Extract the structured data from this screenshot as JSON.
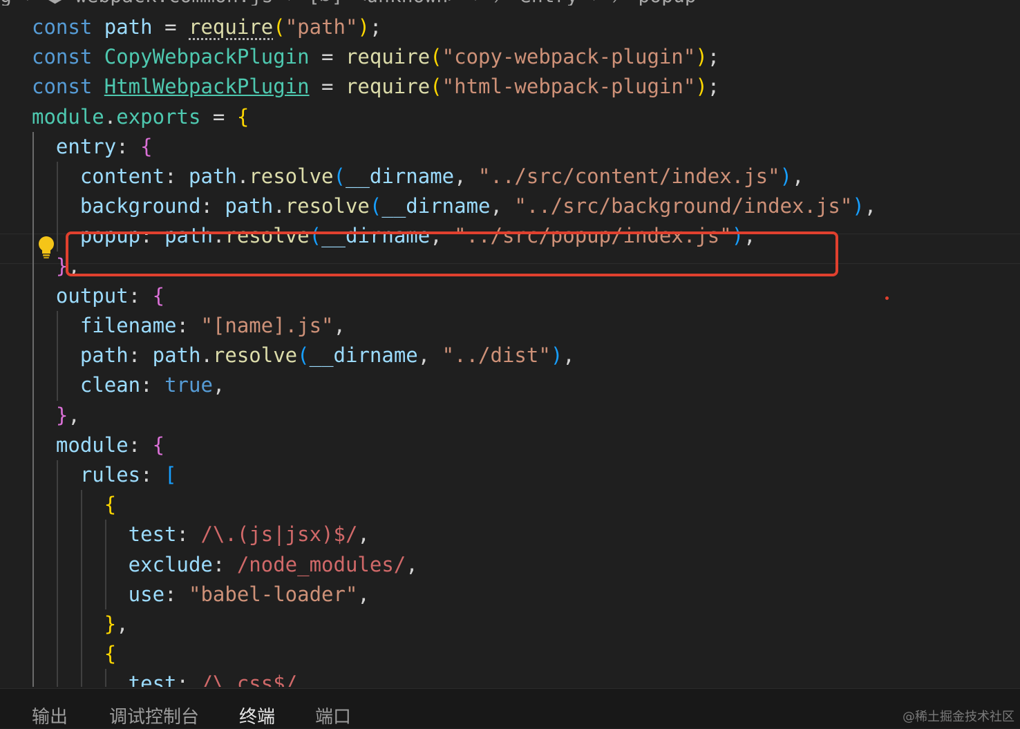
{
  "breadcrumb": {
    "text": "g › ⬢ webpack.common.js › [∅] <unknown> › ⟋ entry › ⟋ popup"
  },
  "editor": {
    "language": "javascript",
    "lines": [
      [
        [
          "t-kw",
          "const "
        ],
        [
          "t-var",
          "path"
        ],
        [
          "t-p",
          " = "
        ],
        [
          "t-fn t-dot",
          "require"
        ],
        [
          "t-b1",
          "("
        ],
        [
          "t-str",
          "\"path\""
        ],
        [
          "t-b1",
          ")"
        ],
        [
          "t-p",
          ";"
        ]
      ],
      [
        [
          "t-kw",
          "const "
        ],
        [
          "t-cls",
          "CopyWebpackPlugin"
        ],
        [
          "t-p",
          " = "
        ],
        [
          "t-fn",
          "require"
        ],
        [
          "t-b1",
          "("
        ],
        [
          "t-str",
          "\"copy-webpack-plugin\""
        ],
        [
          "t-b1",
          ")"
        ],
        [
          "t-p",
          ";"
        ]
      ],
      [
        [
          "t-kw",
          "const "
        ],
        [
          "t-cls t-und",
          "HtmlWebpackPlugin"
        ],
        [
          "t-p",
          " = "
        ],
        [
          "t-fn",
          "require"
        ],
        [
          "t-b1",
          "("
        ],
        [
          "t-str",
          "\"html-webpack-plugin\""
        ],
        [
          "t-b1",
          ")"
        ],
        [
          "t-p",
          ";"
        ]
      ],
      [
        [
          "t-cls",
          "module"
        ],
        [
          "t-p",
          "."
        ],
        [
          "t-cls",
          "exports"
        ],
        [
          "t-p",
          " = "
        ],
        [
          "t-b1",
          "{"
        ]
      ],
      [
        [
          "t-prop",
          "  entry"
        ],
        [
          "t-p",
          ": "
        ],
        [
          "t-b2",
          "{"
        ]
      ],
      [
        [
          "t-prop",
          "    content"
        ],
        [
          "t-p",
          ": "
        ],
        [
          "t-var",
          "path"
        ],
        [
          "t-p",
          "."
        ],
        [
          "t-fn",
          "resolve"
        ],
        [
          "t-b3",
          "("
        ],
        [
          "t-var",
          "__dirname"
        ],
        [
          "t-p",
          ", "
        ],
        [
          "t-str",
          "\"../src/content/index.js\""
        ],
        [
          "t-b3",
          ")"
        ],
        [
          "t-p",
          ","
        ]
      ],
      [
        [
          "t-prop",
          "    background"
        ],
        [
          "t-p",
          ": "
        ],
        [
          "t-var",
          "path"
        ],
        [
          "t-p",
          "."
        ],
        [
          "t-fn",
          "resolve"
        ],
        [
          "t-b3",
          "("
        ],
        [
          "t-var",
          "__dirname"
        ],
        [
          "t-p",
          ", "
        ],
        [
          "t-str",
          "\"../src/background/index.js\""
        ],
        [
          "t-b3",
          ")"
        ],
        [
          "t-p",
          ","
        ]
      ],
      [
        [
          "t-prop",
          "    popup"
        ],
        [
          "t-p",
          ": "
        ],
        [
          "t-var",
          "path"
        ],
        [
          "t-p",
          "."
        ],
        [
          "t-fn",
          "resolve"
        ],
        [
          "t-b3",
          "("
        ],
        [
          "t-var",
          "__dirname"
        ],
        [
          "t-p",
          ", "
        ],
        [
          "t-str",
          "\"../src/popup/index.js\""
        ],
        [
          "t-b3",
          ")"
        ],
        [
          "t-p",
          ","
        ]
      ],
      [
        [
          "t-b2",
          "  }"
        ],
        [
          "t-p",
          ","
        ]
      ],
      [
        [
          "t-prop",
          "  output"
        ],
        [
          "t-p",
          ": "
        ],
        [
          "t-b2",
          "{"
        ]
      ],
      [
        [
          "t-prop",
          "    filename"
        ],
        [
          "t-p",
          ": "
        ],
        [
          "t-str",
          "\"[name].js\""
        ],
        [
          "t-p",
          ","
        ]
      ],
      [
        [
          "t-prop",
          "    path"
        ],
        [
          "t-p",
          ": "
        ],
        [
          "t-var",
          "path"
        ],
        [
          "t-p",
          "."
        ],
        [
          "t-fn",
          "resolve"
        ],
        [
          "t-b3",
          "("
        ],
        [
          "t-var",
          "__dirname"
        ],
        [
          "t-p",
          ", "
        ],
        [
          "t-str",
          "\"../dist\""
        ],
        [
          "t-b3",
          ")"
        ],
        [
          "t-p",
          ","
        ]
      ],
      [
        [
          "t-prop",
          "    clean"
        ],
        [
          "t-p",
          ": "
        ],
        [
          "t-bool",
          "true"
        ],
        [
          "t-p",
          ","
        ]
      ],
      [
        [
          "t-b2",
          "  }"
        ],
        [
          "t-p",
          ","
        ]
      ],
      [
        [
          "t-prop",
          "  module"
        ],
        [
          "t-p",
          ": "
        ],
        [
          "t-b2",
          "{"
        ]
      ],
      [
        [
          "t-prop",
          "    rules"
        ],
        [
          "t-p",
          ": "
        ],
        [
          "t-b3",
          "["
        ]
      ],
      [
        [
          "t-b1",
          "      {"
        ]
      ],
      [
        [
          "t-prop",
          "        test"
        ],
        [
          "t-p",
          ": "
        ],
        [
          "t-re",
          "/\\.(js|jsx)$/"
        ],
        [
          "t-p",
          ","
        ]
      ],
      [
        [
          "t-prop",
          "        exclude"
        ],
        [
          "t-p",
          ": "
        ],
        [
          "t-re",
          "/node_modules/"
        ],
        [
          "t-p",
          ","
        ]
      ],
      [
        [
          "t-prop",
          "        use"
        ],
        [
          "t-p",
          ": "
        ],
        [
          "t-str",
          "\"babel-loader\""
        ],
        [
          "t-p",
          ","
        ]
      ],
      [
        [
          "t-b1",
          "      }"
        ],
        [
          "t-p",
          ","
        ]
      ],
      [
        [
          "t-b1",
          "      {"
        ]
      ],
      [
        [
          "t-prop",
          "        test"
        ],
        [
          "t-p",
          ": "
        ],
        [
          "t-re",
          "/\\.css$/"
        ],
        [
          "t-p",
          ","
        ]
      ]
    ]
  },
  "panel": {
    "tabs": [
      {
        "label": "输出",
        "active": false
      },
      {
        "label": "调试控制台",
        "active": false
      },
      {
        "label": "终端",
        "active": true
      },
      {
        "label": "端口",
        "active": false
      }
    ]
  },
  "watermark": "@稀土掘金技术社区",
  "icons": {
    "lightbulb": "lightbulb-icon"
  },
  "colors": {
    "background": "#1f1f1f",
    "highlight_box": "#e0402e",
    "lightbulb": "#f5c518"
  }
}
